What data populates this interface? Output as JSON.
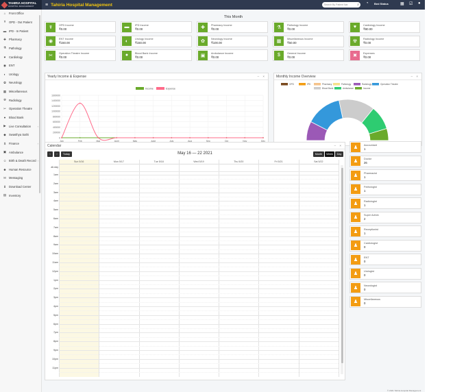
{
  "app": {
    "logo_text": "TAHIRIA HOSPITAL",
    "logo_sub": "HOSPITAL MANAGEMENT",
    "title": "Tahiria Hospital Management",
    "search_placeholder": "Search By Patient Nar",
    "bed_status": "Bed Status",
    "footer": "© 2021 Tahiria Hospital Management"
  },
  "sidebar": {
    "items": [
      {
        "label": "Front Office",
        "icon": "home-icon",
        "glyph": "⌂"
      },
      {
        "label": "OPD - Out Patient",
        "icon": "stethoscope-icon",
        "glyph": "☤"
      },
      {
        "label": "IPD - In Patient",
        "icon": "bed-icon",
        "glyph": "▬"
      },
      {
        "label": "Pharmacy",
        "icon": "pill-icon",
        "glyph": "✚"
      },
      {
        "label": "Pathology",
        "icon": "flask-icon",
        "glyph": "⚗"
      },
      {
        "label": "Cardiology",
        "icon": "heart-icon",
        "glyph": "♥"
      },
      {
        "label": "ENT",
        "icon": "ear-icon",
        "glyph": "◉"
      },
      {
        "label": "Urology",
        "icon": "kidney-icon",
        "glyph": "◐"
      },
      {
        "label": "Neurology",
        "icon": "brain-icon",
        "glyph": "✿"
      },
      {
        "label": "Miscellaneous",
        "icon": "grid-icon",
        "glyph": "▦"
      },
      {
        "label": "Radiology",
        "icon": "xray-icon",
        "glyph": "☢"
      },
      {
        "label": "Operation Theatre",
        "icon": "scalpel-icon",
        "glyph": "✂"
      },
      {
        "label": "Blood Bank",
        "icon": "drop-icon",
        "glyph": "●"
      },
      {
        "label": "Live Consultation",
        "icon": "video-icon",
        "glyph": "▶",
        "arrow": "›"
      },
      {
        "label": "Swasthya Sathi",
        "icon": "shield-icon",
        "glyph": "◆"
      },
      {
        "label": "Finance",
        "icon": "money-icon",
        "glyph": "$",
        "arrow": "›"
      },
      {
        "label": "Ambulance",
        "icon": "ambulance-icon",
        "glyph": "▣"
      },
      {
        "label": "Birth & Death Record",
        "icon": "family-icon",
        "glyph": "☺",
        "arrow": "›"
      },
      {
        "label": "Human Resource",
        "icon": "users-icon",
        "glyph": "☻"
      },
      {
        "label": "Messaging",
        "icon": "envelope-icon",
        "glyph": "✉"
      },
      {
        "label": "Download Center",
        "icon": "download-icon",
        "glyph": "⬇"
      },
      {
        "label": "Inventory",
        "icon": "box-icon",
        "glyph": "▤"
      }
    ]
  },
  "dashboard": {
    "this_month": "This Month",
    "cards": [
      {
        "label": "OPD Income",
        "value": "₹0.00",
        "color": "#6aaa2b",
        "icon": "stethoscope-icon",
        "glyph": "☤"
      },
      {
        "label": "IPD Income",
        "value": "₹0.00",
        "color": "#6aaa2b",
        "icon": "bed-icon",
        "glyph": "▬"
      },
      {
        "label": "Pharmacy Income",
        "value": "₹0.00",
        "color": "#6aaa2b",
        "icon": "pill-icon",
        "glyph": "✚"
      },
      {
        "label": "Pathology Income",
        "value": "₹0.00",
        "color": "#6aaa2b",
        "icon": "flask-icon",
        "glyph": "⚗"
      },
      {
        "label": "Cardiology Income",
        "value": "₹80.00",
        "color": "#6aaa2b",
        "icon": "heart-icon",
        "glyph": "♥"
      },
      {
        "label": "ENT Income",
        "value": "₹150.00",
        "color": "#6aaa2b",
        "icon": "ear-icon",
        "glyph": "◉"
      },
      {
        "label": "Urology Income",
        "value": "₹150.00",
        "color": "#6aaa2b",
        "icon": "kidney-icon",
        "glyph": "◐"
      },
      {
        "label": "Neurology Income",
        "value": "₹100.00",
        "color": "#6aaa2b",
        "icon": "brain-icon",
        "glyph": "✿"
      },
      {
        "label": "Miscellaneous Income",
        "value": "₹50.00",
        "color": "#6aaa2b",
        "icon": "grid-icon",
        "glyph": "▦"
      },
      {
        "label": "Radiology Income",
        "value": "₹0.00",
        "color": "#6aaa2b",
        "icon": "xray-icon",
        "glyph": "☢"
      },
      {
        "label": "Operation Theatre Income",
        "value": "₹0.00",
        "color": "#6aaa2b",
        "icon": "scalpel-icon",
        "glyph": "✂"
      },
      {
        "label": "Blood Bank Income",
        "value": "₹0.00",
        "color": "#6aaa2b",
        "icon": "drop-icon",
        "glyph": "●"
      },
      {
        "label": "Ambulance Income",
        "value": "₹0.00",
        "color": "#6aaa2b",
        "icon": "ambulance-icon",
        "glyph": "▣"
      },
      {
        "label": "General Income",
        "value": "₹0.00",
        "color": "#6aaa2b",
        "icon": "money-icon",
        "glyph": "$"
      },
      {
        "label": "Expenses",
        "value": "₹0.00",
        "color": "#e86b8f",
        "icon": "expense-icon",
        "glyph": "✖"
      }
    ]
  },
  "yearly_panel": {
    "title": "Yearly Income & Expense",
    "controls": "– ×"
  },
  "monthly_panel": {
    "title": "Monthly Income Overview",
    "controls": "– ×"
  },
  "chart_data": [
    {
      "type": "line",
      "title": "",
      "categories": [
        "Jan",
        "Feb",
        "Mar",
        "April",
        "May",
        "June",
        "July",
        "Aug",
        "Sep",
        "Oct",
        "Nov",
        "Dec"
      ],
      "series": [
        {
          "name": "Income",
          "color": "#6aaa2b",
          "values": [
            0,
            0,
            0,
            0,
            0,
            0,
            0,
            0,
            0,
            0,
            0,
            0
          ]
        },
        {
          "name": "Expense",
          "color": "#ff6b8a",
          "values": [
            0,
            1300000,
            0,
            0,
            0,
            0,
            0,
            0,
            0,
            0,
            0,
            0
          ]
        }
      ],
      "ylim": [
        0,
        1600000
      ],
      "yticks": [
        "0",
        "200000",
        "400000",
        "600000",
        "800000",
        "1000000",
        "1200000",
        "1400000",
        "1600000"
      ],
      "legend": "top-center",
      "grid": true
    },
    {
      "type": "pie",
      "title": "",
      "style": "half-donut",
      "categories": [
        "OPD",
        "IPD",
        "Pharmacy",
        "Pathology",
        "Radiology",
        "Operation Theatre",
        "Blood Bank",
        "Ambulance",
        "Income"
      ],
      "colors": [
        "#7a4a1e",
        "#f39c12",
        "#f5c38a",
        "#f7e08a",
        "#9b59b6",
        "#3498db",
        "#cccccc",
        "#2ecc71",
        "#6aaa2b"
      ],
      "values": [
        0,
        0,
        0,
        0,
        80,
        150,
        150,
        100,
        50
      ],
      "legend": "top"
    }
  ],
  "calendar": {
    "title": "Calendar",
    "controls": "– ×",
    "prev": "‹",
    "next": "›",
    "today": "Today",
    "range": "May 16 — 22 2021",
    "views": [
      "Month",
      "Week",
      "Day"
    ],
    "days": [
      "Sun 5/16",
      "Mon 5/17",
      "Tue 5/18",
      "Wed 5/19",
      "Thu 5/20",
      "Fri 5/21",
      "Sat 5/22"
    ],
    "all_day": "all-day",
    "hours": [
      "1am",
      "2am",
      "3am",
      "4am",
      "5am",
      "6am",
      "7am",
      "8am",
      "9am",
      "10am",
      "11am",
      "12pm",
      "1pm",
      "2pm",
      "3pm",
      "4pm",
      "5pm",
      "6pm",
      "7pm",
      "8pm",
      "9pm",
      "10pm",
      "11pm"
    ],
    "today_color": "#fcf8e3"
  },
  "staff": [
    {
      "role": "Accountant",
      "count": "1"
    },
    {
      "role": "Doctor",
      "count": "26"
    },
    {
      "role": "Pharmacist",
      "count": "1"
    },
    {
      "role": "Pathologist",
      "count": "1"
    },
    {
      "role": "Radiologist",
      "count": "1"
    },
    {
      "role": "Super Admin",
      "count": "2"
    },
    {
      "role": "Receptionist",
      "count": "1"
    },
    {
      "role": "Cardiologist",
      "count": "0"
    },
    {
      "role": "ENT",
      "count": "0"
    },
    {
      "role": "Urologist",
      "count": "0"
    },
    {
      "role": "Neurologist",
      "count": "0"
    },
    {
      "role": "Miscellaneous",
      "count": "0"
    }
  ]
}
